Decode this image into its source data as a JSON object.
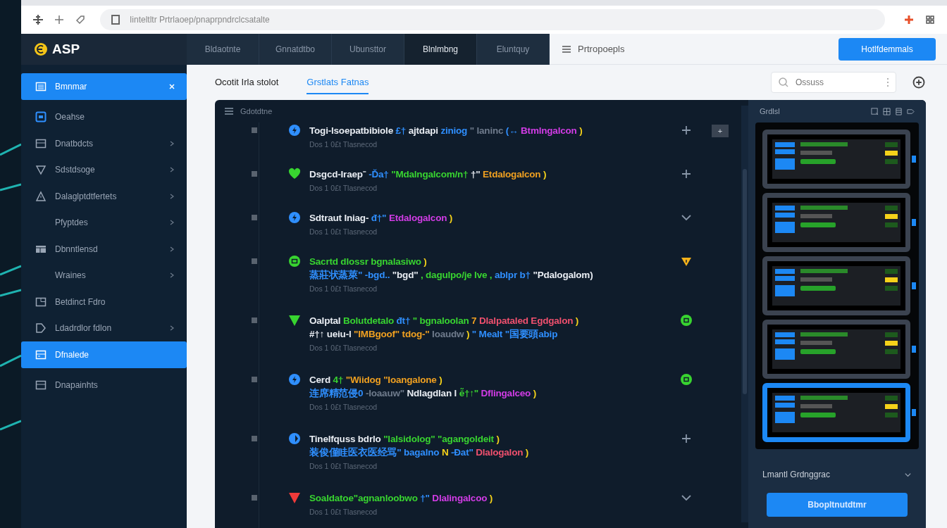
{
  "browser": {
    "address": "Iinteltltr  Prtrlaoep/pnaprpndrclcsatalte"
  },
  "app": {
    "logo": "ASP",
    "tabs": [
      {
        "label": "Bldaotnte",
        "selected": false
      },
      {
        "label": "Gnnatdtbo",
        "selected": false
      },
      {
        "label": "Ubunsttor",
        "selected": false
      },
      {
        "label": "Blnlmbng",
        "selected": true
      },
      {
        "label": "Eluntquy",
        "selected": false
      }
    ],
    "menu_label": "Prtropoepls",
    "primary_button": "Hotlfdemmals"
  },
  "sidebar": {
    "items": [
      {
        "label": "Bmnmar",
        "chevron": false,
        "closable": true,
        "selected": true
      },
      {
        "label": "Oeahse",
        "chevron": false,
        "closable": false,
        "selected": false
      },
      {
        "label": "Dnatbdcts",
        "chevron": true,
        "closable": false,
        "selected": false
      },
      {
        "label": "Sdstdsoge",
        "chevron": true,
        "closable": false,
        "selected": false
      },
      {
        "label": "Dalaglptdtfertets",
        "chevron": true,
        "closable": false,
        "selected": false
      },
      {
        "label": "Pfyptdes",
        "chevron": true,
        "closable": false,
        "selected": false
      },
      {
        "label": "Dbnntlensd",
        "chevron": true,
        "closable": false,
        "selected": false
      },
      {
        "label": "Wraines",
        "chevron": true,
        "closable": false,
        "selected": false
      },
      {
        "label": "Betdinct Fdro",
        "chevron": false,
        "closable": false,
        "selected": false
      },
      {
        "label": "Ldadrdlor fdlon",
        "chevron": true,
        "closable": false,
        "selected": false
      },
      {
        "label": "Dfnalede",
        "chevron": false,
        "closable": false,
        "selected": true
      },
      {
        "label": "Dnapainhts",
        "chevron": false,
        "closable": false,
        "selected": false
      }
    ]
  },
  "view_tabs": [
    {
      "label": "Ocotit Irla stolot",
      "selected": false
    },
    {
      "label": "Grstlats Fatnas",
      "selected": true
    }
  ],
  "search": {
    "placeholder": "Ossuss"
  },
  "log": {
    "title": "Gdotdtne",
    "items": [
      {
        "kind": "bolt",
        "color": "#2f8fff",
        "extra_button": "+",
        "meta": "Dos 1 0£t  Tlasnecod",
        "lines": [
          [
            {
              "text": "Togi-lsoepatbibiole",
              "color": "#e8ecf2"
            },
            {
              "text": "£†",
              "color": "#2f8fff"
            },
            {
              "text": "ajtdapi",
              "color": "#e8ecf2"
            },
            {
              "text": "ziniog",
              "color": "#2f8fff"
            },
            {
              "text": "\" laninc",
              "color": "#6f7b8c"
            },
            {
              "text": "(↔",
              "color": "#2f8fff"
            },
            {
              "text": "Btmlngalcon",
              "color": "#d23ce6"
            },
            {
              "text": ")",
              "color": "#f5d21a"
            }
          ]
        ]
      },
      {
        "kind": "heart",
        "color": "#38d430",
        "meta": "Dos 1 0£t  Tlasnecod",
        "lines": [
          [
            {
              "text": "Dsgcd-Iraep⁻",
              "color": "#e8ecf2"
            },
            {
              "text": "-Ďa†",
              "color": "#2f8fff"
            },
            {
              "text": "\"Mdalngalcom/n†",
              "color": "#38d430"
            },
            {
              "text": "†\"",
              "color": "#e8ecf2"
            },
            {
              "text": "Etdalogalcon",
              "color": "#f0a020"
            },
            {
              "text": ")",
              "color": "#f5d21a"
            }
          ]
        ]
      },
      {
        "kind": "bolt",
        "color": "#2f8fff",
        "meta": "Dos 1 0£t  Tlasnecod",
        "lines": [
          [
            {
              "text": "Sdtraut Iniag-",
              "color": "#e8ecf2"
            },
            {
              "text": "đ†\"",
              "color": "#2f8fff"
            },
            {
              "text": "Etdalogalcon",
              "color": "#d23ce6"
            },
            {
              "text": ")",
              "color": "#f5d21a"
            }
          ]
        ]
      },
      {
        "kind": "square",
        "color": "#38d430",
        "meta": "Dos 1 0£t  Tlasnecod",
        "lines": [
          [
            {
              "text": "Sacrtd dlossr bgnalasiwo",
              "color": "#38d430"
            },
            {
              "text": ")",
              "color": "#f5d21a"
            }
          ],
          [
            {
              "text": "蒸莊状蒸萊\" -bgd..",
              "color": "#2f8fff"
            },
            {
              "text": "\"bgd\"",
              "color": "#e8ecf2"
            },
            {
              "text": ", dagulpo/je Ive ,",
              "color": "#38d430"
            },
            {
              "text": "ablpr b†",
              "color": "#2f8fff"
            },
            {
              "text": "\"Pdalogalom)",
              "color": "#e8ecf2"
            }
          ]
        ]
      },
      {
        "kind": "triangle",
        "color": "#38d430",
        "meta": "Dos 1 0£t  Tlasnecod",
        "lines": [
          [
            {
              "text": "Oalptal",
              "color": "#e8ecf2"
            },
            {
              "text": "Bolutdetalo",
              "color": "#38d430"
            },
            {
              "text": "đt†",
              "color": "#2f8fff"
            },
            {
              "text": "\" bgnaloolan",
              "color": "#38d430"
            },
            {
              "text": "7",
              "color": "#f0a020"
            },
            {
              "text": "Dlalpataled Egdgalon",
              "color": "#f0506e"
            },
            {
              "text": ")",
              "color": "#f5d21a"
            }
          ],
          [
            {
              "text": "#†↑ ueiu-l",
              "color": "#e8ecf2"
            },
            {
              "text": "\"IMBgoof\" tdog-\"",
              "color": "#f0a020"
            },
            {
              "text": "Ioaudw",
              "color": "#6f7b8c"
            },
            {
              "text": ")",
              "color": "#f5d21a"
            },
            {
              "text": "\" Mealt \"国要頭abip",
              "color": "#2f8fff"
            }
          ]
        ]
      },
      {
        "kind": "bolt",
        "color": "#2f8fff",
        "meta": "Dos 1 0£t  Tlasnecod",
        "lines": [
          [
            {
              "text": "Cerd",
              "color": "#e8ecf2"
            },
            {
              "text": "4†",
              "color": "#38d430"
            },
            {
              "text": "\"Wiidog \"Ioangalone",
              "color": "#f0a020"
            },
            {
              "text": ")",
              "color": "#f5d21a"
            }
          ],
          [
            {
              "text": "连席精范侵0",
              "color": "#2f8fff"
            },
            {
              "text": "-Ioaauw\"",
              "color": "#6f7b8c"
            },
            {
              "text": "Ndlagdlan l",
              "color": "#e8ecf2"
            },
            {
              "text": "ễ†↑\"",
              "color": "#38d430"
            },
            {
              "text": "Dflingalceo",
              "color": "#d23ce6"
            },
            {
              "text": ")",
              "color": "#f5d21a"
            }
          ]
        ]
      },
      {
        "kind": "half",
        "color": "#2f8fff",
        "meta": "Dos 1 0£t  Tlasnecod",
        "lines": [
          [
            {
              "text": "Tinelfquss bdrlo",
              "color": "#e8ecf2"
            },
            {
              "text": "\"lalsidolog\" \"agangoldeit",
              "color": "#38d430"
            },
            {
              "text": ")",
              "color": "#f5d21a"
            }
          ],
          [
            {
              "text": "装俊僅眭医衣医经骂\"",
              "color": "#2f8fff"
            },
            {
              "text": "bagalno",
              "color": "#2f8fff"
            },
            {
              "text": "N",
              "color": "#f5d21a"
            },
            {
              "text": "-Đat\"",
              "color": "#2f8fff"
            },
            {
              "text": "Dlalogalon",
              "color": "#f0506e"
            },
            {
              "text": ")",
              "color": "#f5d21a"
            }
          ]
        ]
      },
      {
        "kind": "triangle",
        "color": "#f03a3a",
        "meta": "Dos 1 0£t  Tlasnecod",
        "lines": [
          [
            {
              "text": "Soaldatoe\"agnanloobwo",
              "color": "#38d430"
            },
            {
              "text": "†\"",
              "color": "#2f8fff"
            },
            {
              "text": "Dlalingalcoo",
              "color": "#d23ce6"
            },
            {
              "text": ")",
              "color": "#f5d21a"
            }
          ]
        ]
      }
    ]
  },
  "preview": {
    "title": "Grdlsl",
    "units": [
      {
        "selected": false
      },
      {
        "selected": false
      },
      {
        "selected": false
      },
      {
        "selected": false
      },
      {
        "selected": true
      }
    ],
    "dropdown": "Lmantl Grdnggrac",
    "button": "Bbopltnutdtmr"
  }
}
